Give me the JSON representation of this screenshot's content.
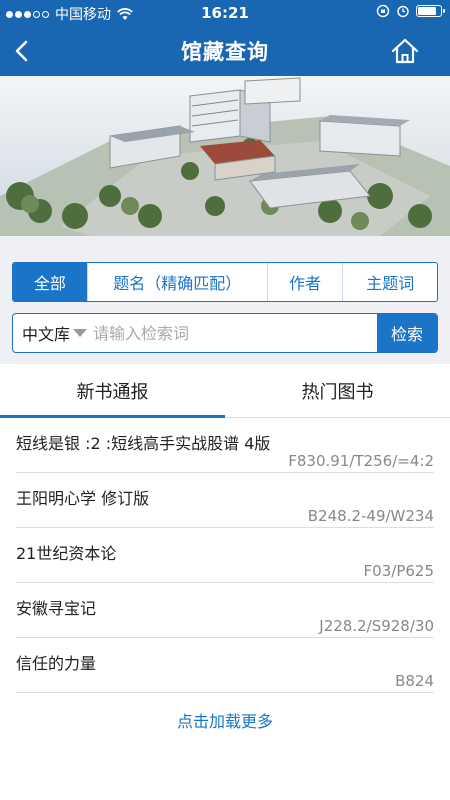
{
  "status_bar": {
    "carrier": "中国移动",
    "time": "16:21",
    "battery_level": 0.85
  },
  "navbar": {
    "title": "馆藏查询",
    "back_icon": "chevron-left-icon",
    "home_icon": "home-icon"
  },
  "search": {
    "tabs": [
      {
        "label": "全部",
        "active": true
      },
      {
        "label": "题名（精确匹配）",
        "active": false
      },
      {
        "label": "作者",
        "active": false
      },
      {
        "label": "主题词",
        "active": false
      }
    ],
    "db_select_value": "中文库",
    "input_value": "",
    "placeholder": "请输入检索词",
    "button_label": "检索"
  },
  "list_tabs": [
    {
      "label": "新书通报",
      "active": true
    },
    {
      "label": "热门图书",
      "active": false
    }
  ],
  "books": [
    {
      "title": "短线是银 :2 :短线高手实战股谱 4版",
      "call_number": "F830.91/T256/=4:2"
    },
    {
      "title": "王阳明心学 修订版",
      "call_number": "B248.2-49/W234"
    },
    {
      "title": "21世纪资本论",
      "call_number": "F03/P625"
    },
    {
      "title": "安徽寻宝记",
      "call_number": "J228.2/S928/30"
    },
    {
      "title": "信任的力量",
      "call_number": "B824"
    }
  ],
  "load_more": "点击加载更多",
  "colors": {
    "primary": "#1a75c9",
    "navbar": "#1967b3",
    "background": "#eef0f3"
  }
}
